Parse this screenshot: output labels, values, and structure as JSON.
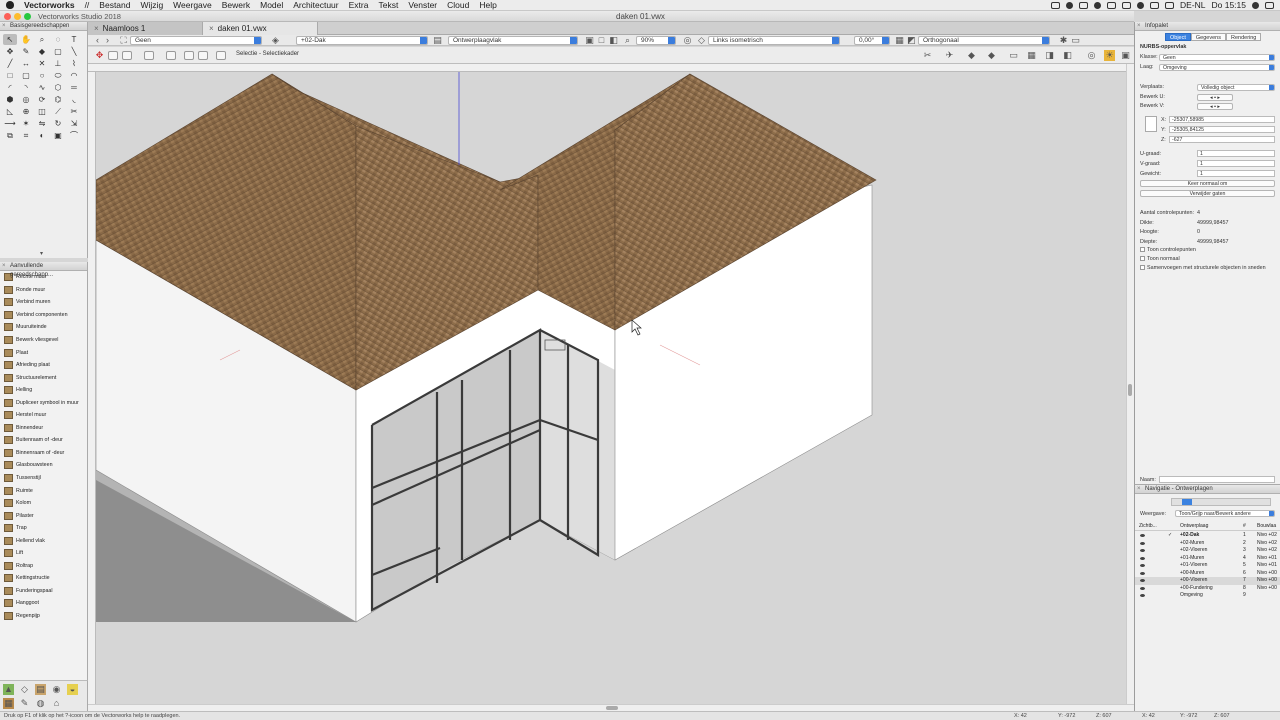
{
  "menubar": {
    "app_name": "Vectorworks",
    "items": [
      "//",
      "Bestand",
      "Wijzig",
      "Weergave",
      "Bewerk",
      "Model",
      "Architectuur",
      "Extra",
      "Tekst",
      "Venster",
      "Cloud",
      "Help"
    ],
    "clock": "Do 15:15",
    "input_source": "DE-NL"
  },
  "titlebar": {
    "app_title": "Vectorworks Studio 2018",
    "document_title": "daken 01.vwx"
  },
  "tabs": [
    {
      "label": "Naamloos 1",
      "active": false
    },
    {
      "label": "daken 01.vwx",
      "active": true
    }
  ],
  "view_bar": {
    "class": "Geen",
    "layer": "+02-Dak",
    "plane": "Ontwerplaagvlak",
    "zoom": "90%",
    "view": "Links isometrisch",
    "rotation": "0,00°",
    "projection": "Orthogonaal"
  },
  "mode_bar": {
    "mode_label": "Selectie - Selectiekader"
  },
  "toolbox": {
    "title": "Basisgereedschappen",
    "icons": [
      "arrow-icon",
      "hand-icon",
      "zoom-icon",
      "flyover-icon",
      "text-icon",
      "pan-icon",
      "eyedropper-icon",
      "attribute-icon",
      "offset-icon",
      "callout-icon",
      "line-icon",
      "dimension-icon",
      "locus-icon",
      "stake-icon",
      "polyline-icon",
      "rectangle-icon",
      "rounded-rect-icon",
      "circle-icon",
      "ellipse-icon",
      "wall-arc-icon",
      "arc-icon",
      "quarter-arc-icon",
      "freehand-icon",
      "polygon-icon",
      "double-line-icon",
      "regular-polygon-icon",
      "spiral-icon",
      "helix-icon",
      "spring-icon",
      "fillet-icon",
      "chamfer-icon",
      "connect-icon",
      "clip-icon",
      "split-icon",
      "trim-icon",
      "extend-icon",
      "symbol-icon",
      "mirror-icon",
      "rotate-icon",
      "move-icon",
      "duplicate-icon",
      "reshape-icon",
      "blend-icon",
      "image-icon",
      "nurbs-icon"
    ]
  },
  "toolset": {
    "title": "Aanvullende gereedschapp...",
    "items": [
      "Rechte muur",
      "Ronde muur",
      "Verbind muren",
      "Verbind componenten",
      "Muuruiteinde",
      "Bewerk vliesgevel",
      "Plaat",
      "Afrieding plaat",
      "Structuurelement",
      "Helling",
      "Dupliceer symbool in muur",
      "Herstel muur",
      "Binnendeur",
      "Buitenraam of -deur",
      "Binnenraam of -deur",
      "Glasbouwsteen",
      "Tussenstijl",
      "Ruimte",
      "Kolom",
      "Pilaster",
      "Trap",
      "Hellend vlak",
      "Lift",
      "Roltrap",
      "Kettingstructie",
      "Funderingspaal",
      "Hanggoot",
      "Regenpijp"
    ]
  },
  "info_palette": {
    "title": "Infopalet",
    "tabs": [
      "Object",
      "Gegevens",
      "Rendering"
    ],
    "object_type": "NURBS-oppervlak",
    "class_label": "Klasse:",
    "class_value": "Geen",
    "layer_label": "Laag:",
    "layer_value": "Omgeving",
    "place_label": "Verplaats:",
    "place_value": "Volledig object",
    "edit_u_label": "Bewerk U:",
    "edit_v_label": "Bewerk V:",
    "x_label": "X:",
    "x_value": "-25307,58985",
    "y_label": "Y:",
    "y_value": "-25305,84125",
    "z_label": "Z:",
    "z_value": "-627",
    "u_degree_label": "U-graad:",
    "u_degree_value": "1",
    "v_degree_label": "V-graad:",
    "v_degree_value": "1",
    "weight_label": "Gewicht:",
    "weight_value": "1",
    "btn_normal": "Keer normaal om",
    "btn_remove_holes": "Verwijder gaten",
    "control_points_label": "Aantal controlepunten:",
    "control_points_value": "4",
    "thickness_label": "Dikte:",
    "thickness_value": "49999,98457",
    "height_label": "Hoogte:",
    "height_value": "0",
    "depth_label": "Diepte:",
    "depth_value": "49999,98457",
    "cb_show_cp": "Toon controlepunten",
    "cb_show_normal": "Toon normaal",
    "cb_merge": "Samenvoegen met structurele objecten in sneden",
    "name_label": "Naam:"
  },
  "navigation": {
    "title": "Navigatie - Ontwerplagen",
    "view_label": "Weergave:",
    "view_value": "Toon/Grijp naar/Bewerk andere",
    "col_visibility": "Zichtb...",
    "col_layer": "Ontwerplaag",
    "col_num": "#",
    "col_layer_level": "Bouwlaa",
    "rows": [
      {
        "name": "+02-Dak",
        "num": "1",
        "level": "Nivo +02",
        "active": true
      },
      {
        "name": "+02-Muren",
        "num": "2",
        "level": "Nivo +02",
        "active": false
      },
      {
        "name": "+02-Vloeren",
        "num": "3",
        "level": "Nivo +02",
        "active": false
      },
      {
        "name": "+01-Muren",
        "num": "4",
        "level": "Nivo +01",
        "active": false
      },
      {
        "name": "+01-Vloeren",
        "num": "5",
        "level": "Nivo +01",
        "active": false
      },
      {
        "name": "+00-Muren",
        "num": "6",
        "level": "Nivo +00",
        "active": false
      },
      {
        "name": "+00-Vloeren",
        "num": "7",
        "level": "Nivo +00",
        "active": false
      },
      {
        "name": "+00-Fundering",
        "num": "8",
        "level": "Nivo +00",
        "active": false
      },
      {
        "name": "Omgeving",
        "num": "9",
        "level": "",
        "active": false
      }
    ]
  },
  "statusbar": {
    "hint": "Druk op F1 of klik op het ?-icoon om de Vectorworks help te raadplegen.",
    "x_readout": "X: 42",
    "y_readout": "Y: -972",
    "z_readout": "Z: 607"
  },
  "colors": {
    "accent": "#3b82e0",
    "roof": "#8a6a48",
    "wall": "#ffffff",
    "canvas": "#d6d6d6"
  }
}
